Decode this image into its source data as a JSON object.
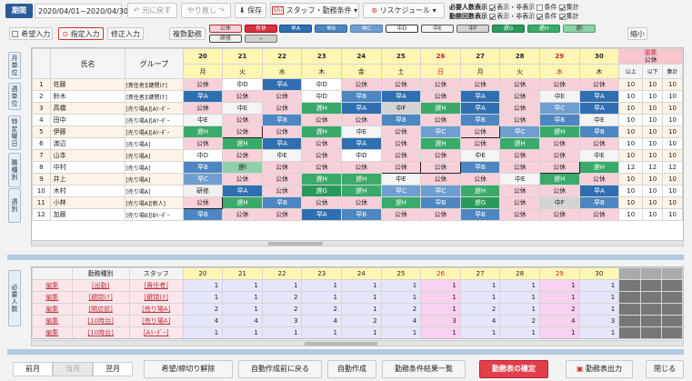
{
  "header": {
    "period_label": "期間",
    "period_value": "2020/04/01~2020/04/30",
    "undo": "元に戻す",
    "redo": "やり直し",
    "save": "保存",
    "staff_cond": "スタッフ・勤務条件",
    "reschedule": "リスケジュール"
  },
  "display": {
    "req_label": "必要人数表示",
    "work_label": "勤務回数表示",
    "show_hide": "表示・非表示",
    "cond": "条件",
    "total": "集計"
  },
  "toolbar": {
    "request_input": "希望入力",
    "assign_input": "指定入力",
    "fix_input": "修正入力",
    "multi": "複数勤務",
    "shrink": "縮小"
  },
  "legend": [
    {
      "label": "公休",
      "bg": "#f8d0da",
      "bd": "#d02030"
    },
    {
      "label": "有休",
      "bg": "#d93040",
      "bd": "#a01020",
      "fg": "#fff"
    },
    {
      "label": "早A",
      "bg": "#2f6fb0",
      "bd": "#1d4f88",
      "fg": "#fff"
    },
    {
      "label": "早B",
      "bg": "#4d86c0",
      "bd": "#2a5f98",
      "fg": "#fff"
    },
    {
      "label": "早C",
      "bg": "#6f9fd0",
      "bd": "#4a7cb0",
      "fg": "#fff"
    },
    {
      "label": "中D",
      "bg": "#ffffff",
      "bd": "#333"
    },
    {
      "label": "中E",
      "bg": "#f4f4f4",
      "bd": "#555"
    },
    {
      "label": "中F",
      "bg": "#d4d4d4",
      "bd": "#666"
    },
    {
      "label": "遅G",
      "bg": "#2a9a5a",
      "bd": "#1a7a40",
      "fg": "#fff"
    },
    {
      "label": "遅H",
      "bg": "#3aaa6a",
      "bd": "#228850",
      "fg": "#fff"
    },
    {
      "label": "遅I",
      "bg": "#8fd0a8",
      "bd": "#50a070"
    },
    {
      "label": "研修",
      "bg": "#f0f0f0",
      "bd": "#444"
    },
    {
      "label": "−",
      "bg": "#cfcfcf",
      "bd": "#777"
    }
  ],
  "side_tabs": [
    "月単位",
    "週単位",
    "特定曜日",
    "職種別",
    "週別"
  ],
  "side_tab2": "必要人数",
  "grid": {
    "col_name": "氏名",
    "col_group": "グループ",
    "dates": [
      "20",
      "21",
      "22",
      "23",
      "24",
      "25",
      "26",
      "27",
      "28",
      "29",
      "30"
    ],
    "dows": [
      "月",
      "火",
      "水",
      "木",
      "金",
      "土",
      "日",
      "月",
      "火",
      "水",
      "木"
    ],
    "date_colors": [
      "#222",
      "#222",
      "#222",
      "#222",
      "#222",
      "#222",
      "#d02030",
      "#222",
      "#222",
      "#d02030",
      "#222"
    ],
    "summary_head": "揃集",
    "summary_kind": "公休",
    "summary_cols": [
      "以上",
      "以下",
      "集計"
    ],
    "staff": [
      {
        "no": "1",
        "name": "佐藤",
        "group": "[責任者][鍵閉け]",
        "s": [
          "公休",
          "中D",
          "早A",
          "中D",
          "公休",
          "公休",
          "公休",
          "公休",
          "公休",
          "公休",
          "公休"
        ],
        "sum": [
          "10",
          "10",
          "10"
        ]
      },
      {
        "no": "2",
        "name": "鈴木",
        "group": "[責任者][鍵閉け]",
        "s": [
          "早A",
          "公休",
          "公休",
          "中D",
          "早B",
          "早A",
          "公休",
          "早A",
          "公休",
          "中E",
          "早A"
        ],
        "sum": [
          "10",
          "10",
          "10"
        ]
      },
      {
        "no": "3",
        "name": "高橋",
        "group": "[売り場A][Aﾘｰﾀﾞｰ",
        "s": [
          "公休",
          "中E",
          "公休",
          "遅H",
          "早A",
          "中F",
          "遅H",
          "早A",
          "公休",
          "早C",
          "早A"
        ],
        "sum": [
          "10",
          "10",
          "10"
        ]
      },
      {
        "no": "4",
        "name": "田中",
        "group": "[売り場A][Aﾘｰﾀﾞｰ",
        "s": [
          "中E",
          "公休",
          "早B",
          "公休",
          "公休",
          "早B",
          "公休",
          "早B",
          "公休",
          "早B",
          "中E"
        ],
        "sum": [
          "10",
          "10",
          "10"
        ]
      },
      {
        "no": "5",
        "name": "伊藤",
        "group": "[売り場A][Aﾘｰﾀﾞｰ",
        "s": [
          "遅H",
          "公休",
          "公休",
          "遅H",
          "中E",
          "公休",
          "早C",
          "公休",
          "早C",
          "遅H",
          "早B"
        ],
        "sum": [
          "10",
          "10",
          "10"
        ]
      },
      {
        "no": "6",
        "name": "渡辺",
        "group": "[売り場A]",
        "s": [
          "公休",
          "遅H",
          "早A",
          "公休",
          "早A",
          "公休",
          "遅H",
          "公休",
          "遅H",
          "公休",
          "公休"
        ],
        "sum": [
          "10",
          "10",
          "10"
        ]
      },
      {
        "no": "7",
        "name": "山本",
        "group": "[売り場A]",
        "s": [
          "中D",
          "公休",
          "中E",
          "公休",
          "中D",
          "公休",
          "公休",
          "中E",
          "公休",
          "公休",
          "中E"
        ],
        "sum": [
          "10",
          "10",
          "10"
        ]
      },
      {
        "no": "8",
        "name": "中村",
        "group": "[売り場A]",
        "s": [
          "早B",
          "遅I",
          "公休",
          "公休",
          "公休",
          "公休",
          "公休",
          "早B",
          "公休",
          "公休",
          "遅H"
        ],
        "sum": [
          "12",
          "12",
          "12"
        ]
      },
      {
        "no": "9",
        "name": "井上",
        "group": "[売り場A]",
        "s": [
          "早C",
          "公休",
          "公休",
          "遅H",
          "遅H",
          "中E",
          "公休",
          "公休",
          "中E",
          "遅H",
          "公休"
        ],
        "sum": [
          "10",
          "10",
          "10"
        ]
      },
      {
        "no": "10",
        "name": "木村",
        "group": "[売り場A]",
        "s": [
          "研修",
          "早A",
          "公休",
          "遅G",
          "遅H",
          "早C",
          "早C",
          "遅H",
          "公休",
          "公休",
          "早A"
        ],
        "sum": [
          "10",
          "10",
          "10"
        ]
      },
      {
        "no": "11",
        "name": "小林",
        "group": "[売り場A][新人]",
        "s": [
          "公休",
          "遅H",
          "早B",
          "公休",
          "公休",
          "遅H",
          "早B",
          "遅G",
          "公休",
          "中F",
          "早B"
        ],
        "sum": [
          "10",
          "10",
          "10"
        ]
      },
      {
        "no": "12",
        "name": "加藤",
        "group": "[売り場B][Bﾘｰﾀﾞｰ",
        "s": [
          "早B",
          "公休",
          "公休",
          "早A",
          "早B",
          "公休",
          "公休",
          "早B",
          "公休",
          "公休",
          "公休"
        ],
        "sum": [
          "10",
          "10",
          "10"
        ]
      }
    ]
  },
  "req": {
    "col_kind": "勤務種別",
    "col_staff": "スタッフ",
    "rows": [
      {
        "edit": "編集",
        "kind": "[出勤]",
        "staff": "[責任者]",
        "v": [
          "1",
          "1",
          "1",
          "1",
          "1",
          "1",
          "1",
          "1",
          "1",
          "1",
          "1"
        ]
      },
      {
        "edit": "編集",
        "kind": "[鍵閉け]",
        "staff": "[鍵閉け]",
        "v": [
          "1",
          "1",
          "2",
          "1",
          "1",
          "1",
          "1",
          "1",
          "1",
          "1",
          "1"
        ]
      },
      {
        "edit": "編集",
        "kind": "[開店前]",
        "staff": "[売り場A]",
        "v": [
          "2",
          "1",
          "2",
          "2",
          "1",
          "2",
          "1",
          "2",
          "1",
          "2",
          "1"
        ]
      },
      {
        "edit": "編集",
        "kind": "[10時台]",
        "staff": "[売り場A]",
        "v": [
          "4",
          "4",
          "3",
          "4",
          "2",
          "4",
          "3",
          "4",
          "2",
          "4",
          "3"
        ]
      },
      {
        "edit": "編集",
        "kind": "[10時台]",
        "staff": "[Aﾘｰﾀﾞｰ]",
        "v": [
          "1",
          "1",
          "1",
          "1",
          "1",
          "1",
          "1",
          "1",
          "1",
          "1",
          "1"
        ]
      }
    ]
  },
  "footer": {
    "prev": "前月",
    "cur": "当月",
    "next": "翌月",
    "clear": "希望/締切り解除",
    "revert": "自動作成前に戻る",
    "auto": "自動作成",
    "result": "勤務条件結果一覧",
    "confirm": "勤務表の確定",
    "export": "勤務表出力",
    "close": "閉じる"
  }
}
